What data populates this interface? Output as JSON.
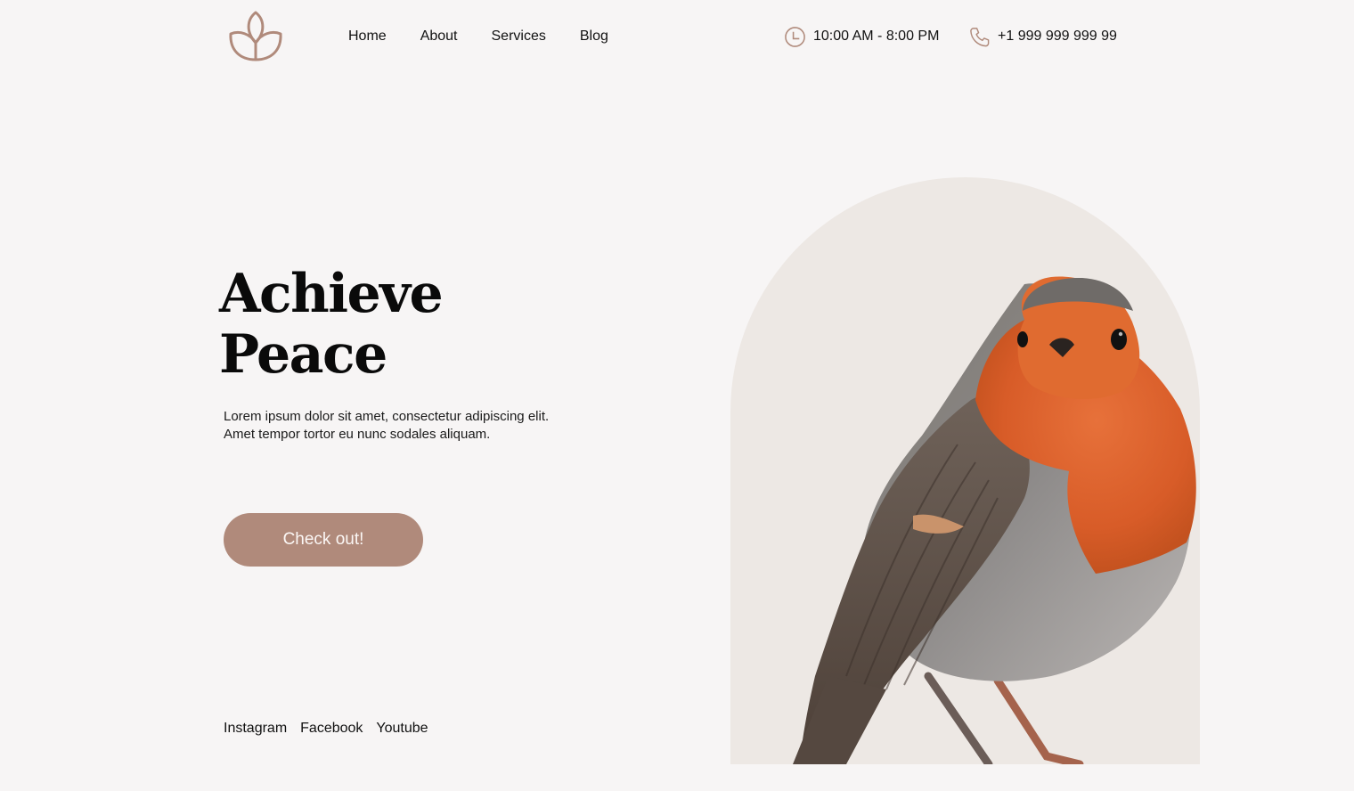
{
  "nav": {
    "items": [
      {
        "label": "Home"
      },
      {
        "label": "About"
      },
      {
        "label": "Services"
      },
      {
        "label": "Blog"
      }
    ]
  },
  "header": {
    "hours": {
      "icon": "clock-icon",
      "text": "10:00 AM - 8:00 PM"
    },
    "phone": {
      "icon": "phone-icon",
      "text": "+1 999 999 999 99"
    }
  },
  "hero": {
    "title_line1": "Achieve",
    "title_line2": "Peace",
    "text_line1": "Lorem ipsum dolor sit amet, consectetur adipiscing elit.",
    "text_line2": "Amet tempor tortor eu nunc sodales aliquam.",
    "cta_label": "Check out!"
  },
  "social": {
    "items": [
      {
        "label": "Instagram"
      },
      {
        "label": "Facebook"
      },
      {
        "label": "Youtube"
      }
    ]
  },
  "colors": {
    "accent": "#b08a7b",
    "background": "#f7f5f5",
    "arch": "#ede8e4"
  }
}
